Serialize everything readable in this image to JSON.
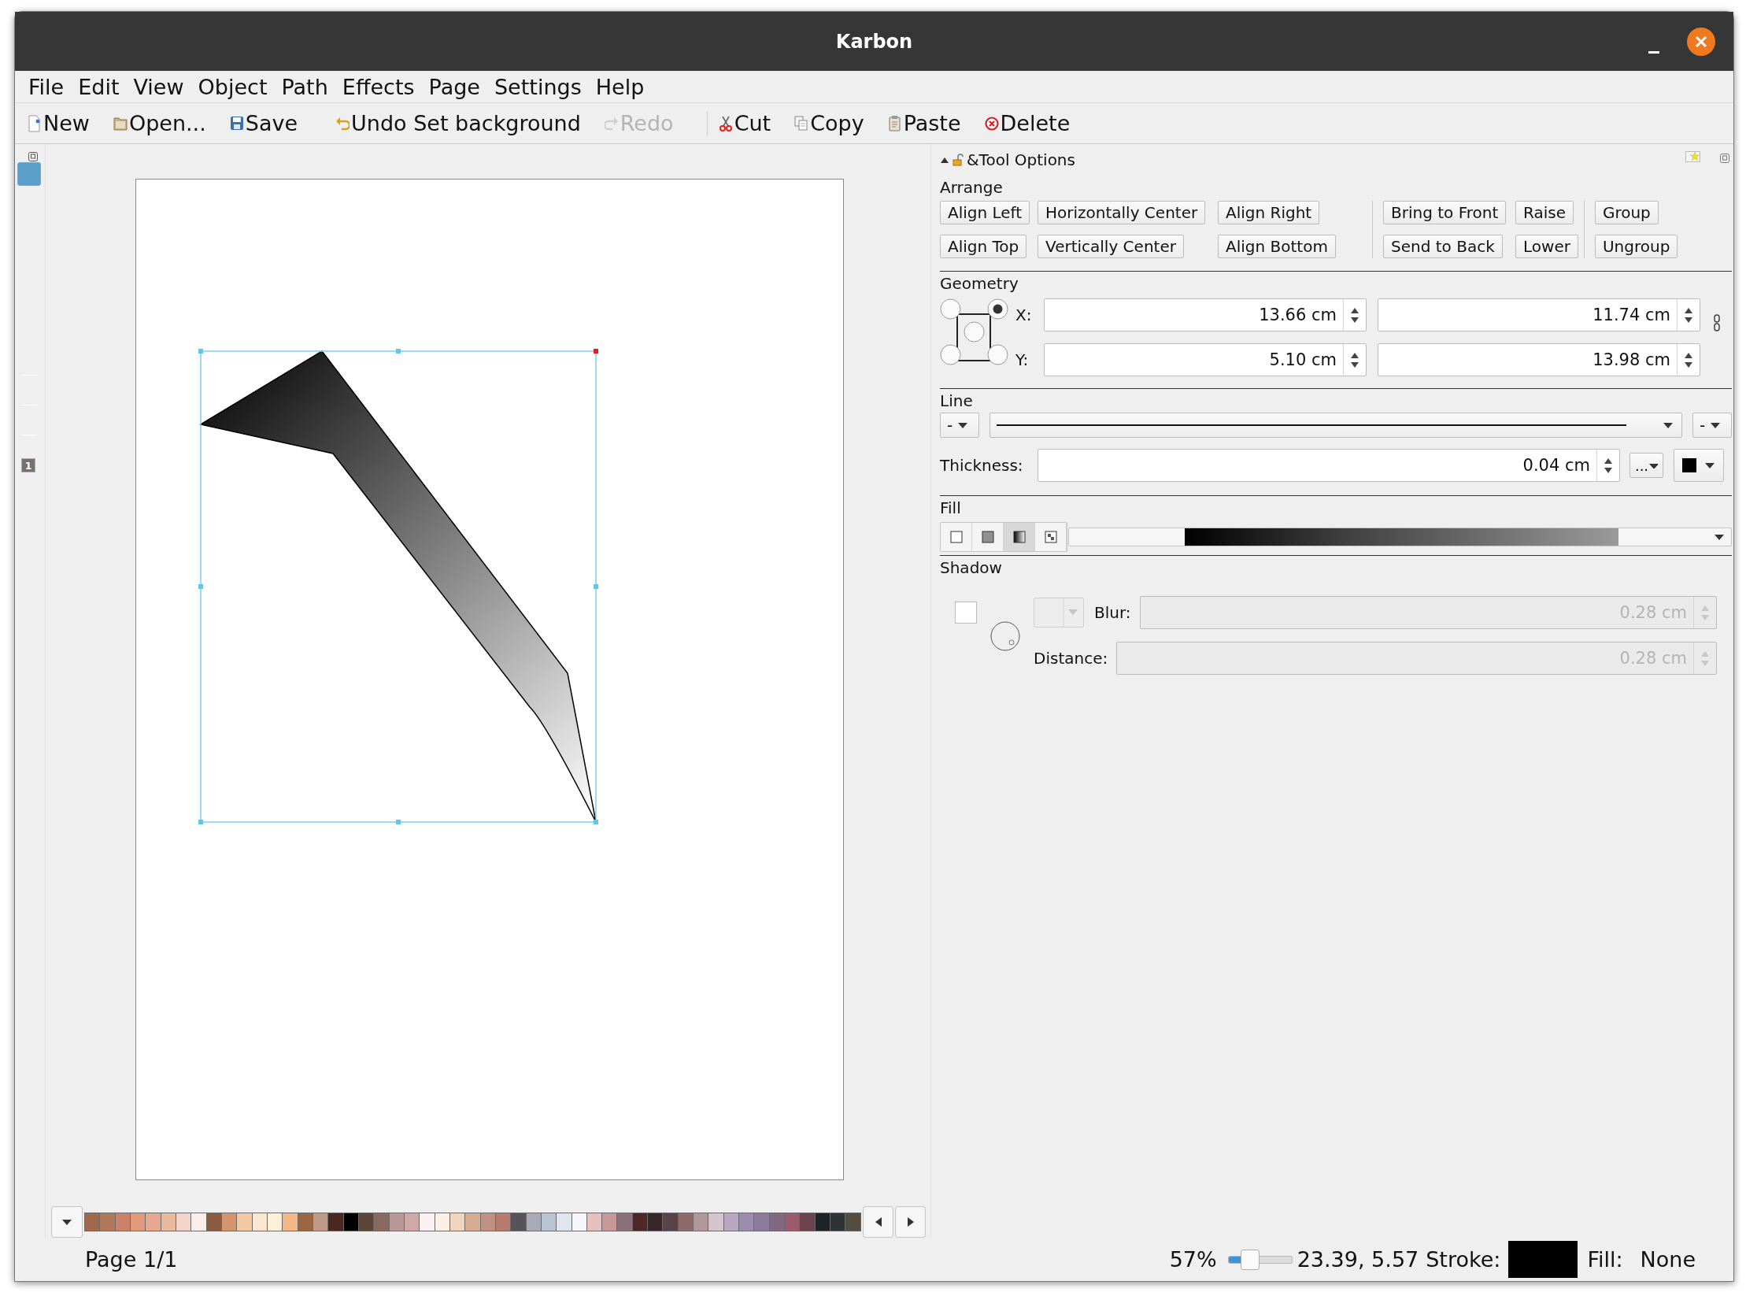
{
  "window": {
    "title": "Karbon"
  },
  "menu": [
    "File",
    "Edit",
    "View",
    "Object",
    "Path",
    "Effects",
    "Page",
    "Settings",
    "Help"
  ],
  "toolbar": [
    {
      "label": "New",
      "disabled": false
    },
    {
      "label": "Open...",
      "disabled": false
    },
    {
      "label": "Save",
      "disabled": false
    },
    {
      "label": "Undo Set background",
      "disabled": false
    },
    {
      "label": "Redo",
      "disabled": true
    },
    {
      "label": "Cut",
      "disabled": false
    },
    {
      "label": "Copy",
      "disabled": false
    },
    {
      "label": "Paste",
      "disabled": false
    },
    {
      "label": "Delete",
      "disabled": false
    }
  ],
  "left_strip": {
    "page_badge": "1"
  },
  "tool_options": {
    "title": "&Tool Options",
    "arrange": {
      "label": "Arrange",
      "groups": [
        [
          [
            "Align Left",
            "Horizontally Center",
            "Align Right"
          ],
          [
            "Align Top",
            "Vertically Center",
            "Align Bottom"
          ]
        ],
        [
          [
            "Bring to Front",
            "Raise"
          ],
          [
            "Send to Back",
            "Lower"
          ]
        ],
        [
          [
            "Group"
          ],
          [
            "Ungroup"
          ]
        ]
      ]
    },
    "geometry": {
      "label": "Geometry",
      "anchor_points": [
        {
          "selected": false
        },
        {
          "selected": true
        },
        {
          "selected": false
        },
        {
          "selected": false
        },
        {
          "selected": false
        }
      ],
      "rows": [
        {
          "label": "X:",
          "values": [
            "13.66 cm",
            "11.74 cm"
          ]
        },
        {
          "label": "Y:",
          "values": [
            "5.10 cm",
            "13.98 cm"
          ]
        }
      ]
    },
    "line": {
      "label": "Line",
      "start_marker": "-",
      "end_marker": "-",
      "thickness_label": "Thickness:",
      "thickness": "0.04 cm",
      "dash_button": "..."
    },
    "fill": {
      "label": "Fill",
      "modes": [
        {
          "selected": false
        },
        {
          "selected": false
        },
        {
          "selected": true
        },
        {
          "selected": false
        }
      ]
    },
    "shadow": {
      "label": "Shadow",
      "checked": false,
      "disabled": true,
      "blur_label": "Blur:",
      "blur": "0.28 cm",
      "distance_label": "Distance:",
      "distance": "0.28 cm"
    }
  },
  "palette": {
    "swatches": [
      {
        "color": "#a0694a"
      },
      {
        "color": "#b07a5a"
      },
      {
        "color": "#cc8266"
      },
      {
        "color": "#e09a7a"
      },
      {
        "color": "#e8a890"
      },
      {
        "color": "#ebb8a0"
      },
      {
        "color": "#f2d4c8"
      },
      {
        "color": "#fbeeea"
      },
      {
        "color": "#8a5a40"
      },
      {
        "color": "#d4946e"
      },
      {
        "color": "#f4c8a0"
      },
      {
        "color": "#fbe6d2"
      },
      {
        "color": "#fdf0d8"
      },
      {
        "color": "#f4b888"
      },
      {
        "color": "#9e6640"
      },
      {
        "color": "#c09a88"
      },
      {
        "color": "#4a2820"
      },
      {
        "color": "#000000"
      },
      {
        "color": "#5a4438"
      },
      {
        "color": "#8a6a60"
      },
      {
        "color": "#b89898"
      },
      {
        "color": "#d0a8a8"
      },
      {
        "color": "#fdf0f0"
      },
      {
        "color": "#fcefe4"
      },
      {
        "color": "#f0d4bc"
      },
      {
        "color": "#d8ac90"
      },
      {
        "color": "#c09080"
      },
      {
        "color": "#b87a6e"
      },
      {
        "color": "#58525a"
      },
      {
        "color": "#a8aab8"
      },
      {
        "color": "#b8c4d4"
      },
      {
        "color": "#e0e6ee"
      },
      {
        "color": "#f4f6fc"
      },
      {
        "color": "#e8c0c0"
      },
      {
        "color": "#c89898"
      },
      {
        "color": "#8a7078"
      },
      {
        "color": "#4e2828"
      },
      {
        "color": "#362828"
      },
      {
        "color": "#584448"
      },
      {
        "color": "#8c6868"
      },
      {
        "color": "#b09898"
      },
      {
        "color": "#d4c4cc"
      },
      {
        "color": "#b8a8c4"
      },
      {
        "color": "#9c8cb0"
      },
      {
        "color": "#8c7c9c"
      },
      {
        "color": "#806880"
      },
      {
        "color": "#985c6c"
      },
      {
        "color": "#6c4450"
      },
      {
        "color": "#1c2428"
      },
      {
        "color": "#2c3434"
      },
      {
        "color": "#544c40"
      }
    ]
  },
  "status_bar": {
    "page": "Page 1/1",
    "zoom": "57%",
    "zoom_slider": {
      "level": 0.3
    },
    "position": "23.39, 5.57",
    "stroke_label": "Stroke:",
    "fill_label": "Fill:",
    "fill_value": "None"
  }
}
